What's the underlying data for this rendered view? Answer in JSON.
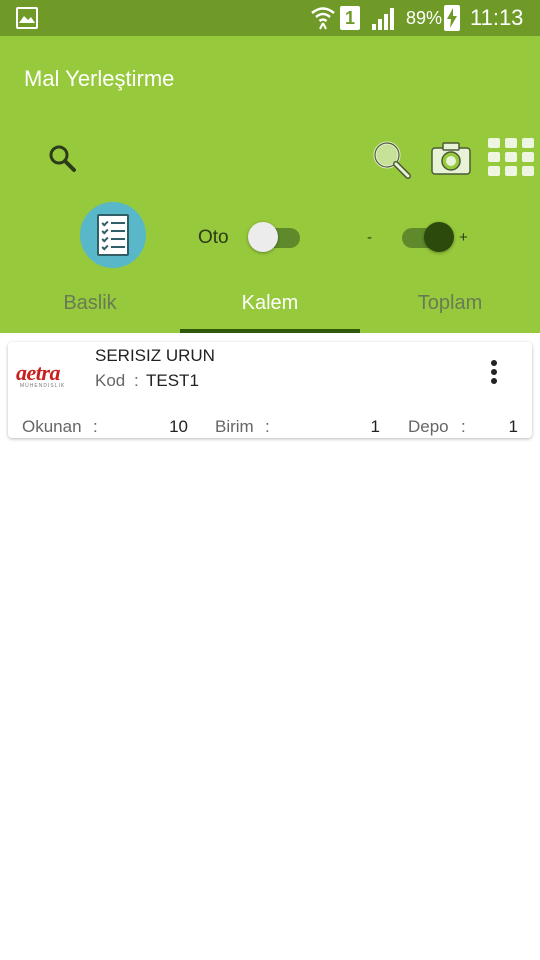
{
  "status_bar": {
    "battery_percent": "89%",
    "sim_slot": "1",
    "time": "11:13",
    "color": "#6f9a28"
  },
  "app_bar": {
    "title": "Mal Yerleştirme",
    "color": "#97c93c",
    "icons": [
      "search-icon",
      "magnifier-icon",
      "camera-icon",
      "grid-icon",
      "checklist-icon"
    ]
  },
  "controls": {
    "oto_label": "Oto",
    "oto_toggle_on": false,
    "minus_label": "-",
    "plus_label": "+",
    "plus_minus_toggle_on": true
  },
  "tabs": [
    {
      "label": "Baslik",
      "selected": false
    },
    {
      "label": "Kalem",
      "selected": true
    },
    {
      "label": "Toplam",
      "selected": false
    }
  ],
  "card": {
    "logo_text": "aetra",
    "logo_sub": "MÜHENDISLIK",
    "product_name": "SERISIZ URUN",
    "kod_label": "Kod",
    "kod_sep": ":",
    "kod_value": "TEST1",
    "stats": [
      {
        "label": "Okunan",
        "sep": ":",
        "value": "10"
      },
      {
        "label": "Birim",
        "sep": ":",
        "value": "1"
      },
      {
        "label": "Depo",
        "sep": ":",
        "value": "1"
      }
    ]
  }
}
